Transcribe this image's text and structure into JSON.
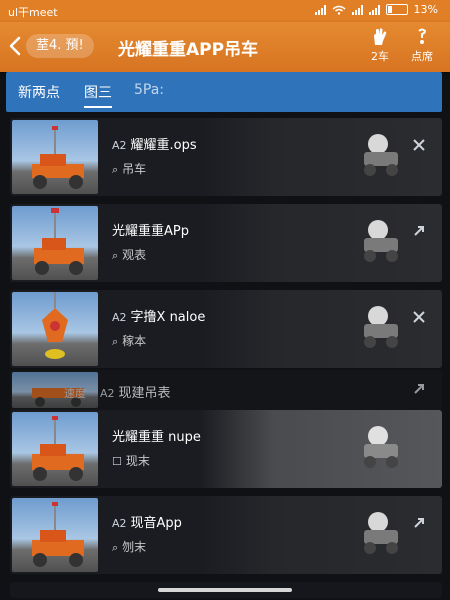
{
  "status": {
    "left": "ul干meet",
    "battery": "13%"
  },
  "header": {
    "back": "<",
    "pill": "荎4. 預!",
    "title": "光耀重重APP吊车",
    "btn1_label": "2车",
    "btn2_label": "点席"
  },
  "tabs": [
    "新两点",
    "图三",
    "5Pa:"
  ],
  "rows": [
    {
      "title": "耀耀重.ops",
      "title_prefix": "A2",
      "subtitle": "吊车",
      "action": "×"
    },
    {
      "title": "光耀重重APp",
      "title_prefix": "",
      "subtitle": "观表",
      "action": "↗"
    },
    {
      "title": "字撸X naloe",
      "title_prefix": "A2",
      "subtitle": "稼本",
      "action": "×"
    },
    {
      "title": "现建吊表",
      "title_prefix": "A2",
      "subtitle": "",
      "prefix_left": "速度",
      "action": "↗"
    },
    {
      "title": "光耀重重 nupe",
      "title_prefix": "",
      "subtitle": "现末",
      "action": ""
    },
    {
      "title": "现音App",
      "title_prefix": "A2",
      "subtitle": "刎末",
      "action": "↗"
    }
  ],
  "colors": {
    "header": "#e07f26",
    "tabs": "#2f73ba"
  }
}
